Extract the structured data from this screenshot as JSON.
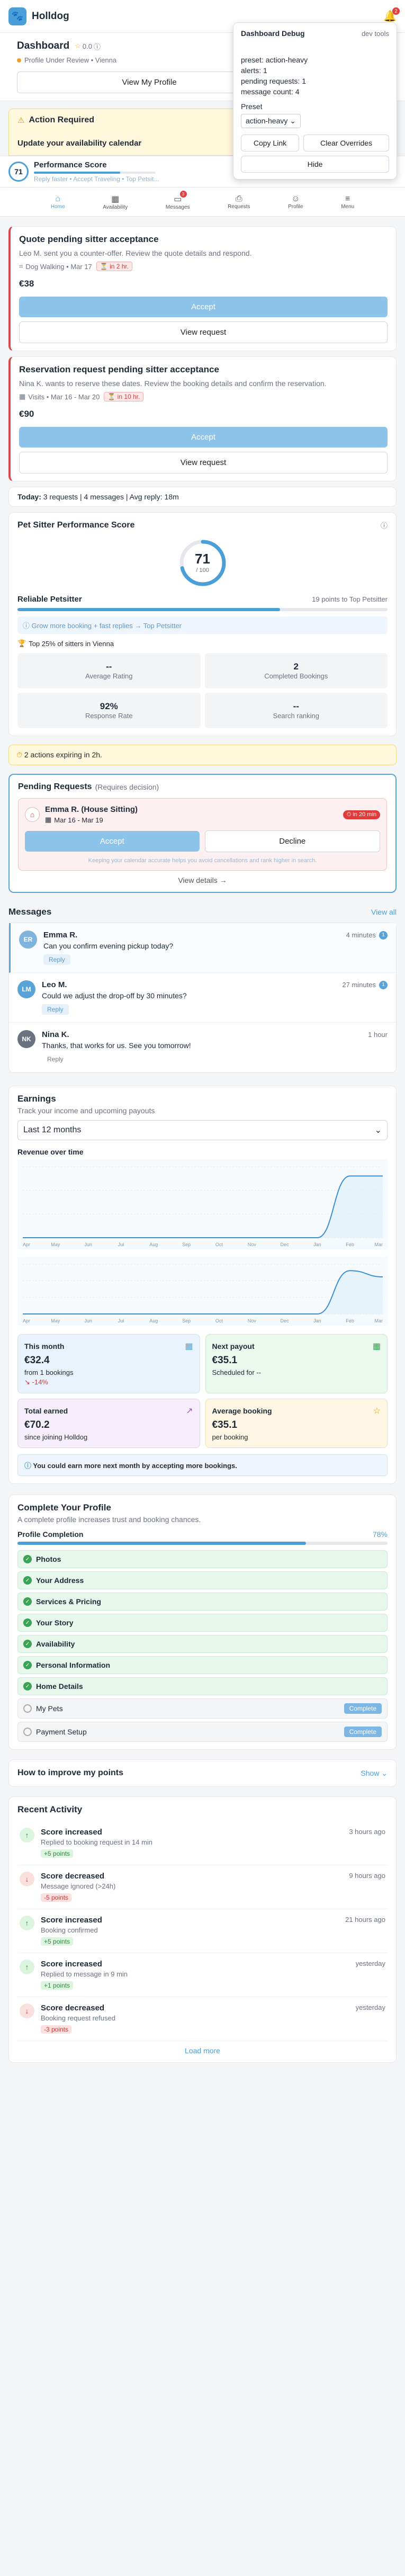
{
  "app": {
    "title": "Holldog",
    "notifications": "2"
  },
  "debug": {
    "title": "Dashboard Debug",
    "tag": "dev tools",
    "lines": [
      "preset: action-heavy",
      "alerts: 1",
      "pending requests: 1",
      "message count: 4"
    ],
    "preset_label": "Preset",
    "preset_value": "action-heavy",
    "copy_link": "Copy Link",
    "clear_overrides": "Clear Overrides",
    "hide": "Hide"
  },
  "dashboard": {
    "title": "Dashboard",
    "rating": "0.0",
    "status": "Profile Under Review • Vienna",
    "view_profile": "View My Profile"
  },
  "action_required": {
    "title": "Action Required",
    "update_calendar": "Update your availability calendar",
    "performance_title": "Performance Score",
    "performance_score": "71",
    "performance_sub": "Reply faster • Accept Traveling • Top Petsit..."
  },
  "bottom_nav": [
    {
      "label": "Home",
      "icon": "home-icon"
    },
    {
      "label": "Availability",
      "icon": "calendar-icon"
    },
    {
      "label": "Messages",
      "icon": "message-icon",
      "badge": "3"
    },
    {
      "label": "Requests",
      "icon": "inbox-icon"
    },
    {
      "label": "Profile",
      "icon": "user-icon"
    },
    {
      "label": "Menu",
      "icon": "menu-icon"
    }
  ],
  "requests": [
    {
      "title": "Quote pending sitter acceptance",
      "desc": "Leo M. sent you a counter-offer. Review the quote details and respond.",
      "meta": "Dog Walking • Mar 17",
      "timer": "in 2 hr.",
      "price": "€38",
      "accept": "Accept",
      "view": "View request"
    },
    {
      "title": "Reservation request pending sitter acceptance",
      "desc": "Nina K. wants to reserve these dates. Review the booking details and confirm the reservation.",
      "meta": "Visits • Mar 16 - Mar 20",
      "timer": "in 10 hr.",
      "price": "€90",
      "accept": "Accept",
      "view": "View request"
    }
  ],
  "today": {
    "label": "Today:",
    "text": "3 requests | 4 messages | Avg reply: 18m"
  },
  "perf_card": {
    "title": "Pet Sitter Performance Score",
    "score": "71",
    "out_of": "/ 100",
    "level": "Reliable Petsitter",
    "to_next": "19 points to Top Petsitter",
    "hint": "Grow more booking + fast replies → Top Petsitter",
    "rank": "Top 25% of sitters in Vienna",
    "stats": [
      {
        "value": "--",
        "label": "Average Rating"
      },
      {
        "value": "2",
        "label": "Completed Bookings"
      },
      {
        "value": "92%",
        "label": "Response Rate"
      },
      {
        "value": "--",
        "label": "Search ranking"
      }
    ]
  },
  "expiring": {
    "text": "2 actions expiring in 2h."
  },
  "pending": {
    "title": "Pending Requests",
    "subtitle": "(Requires decision)",
    "name": "Emma R. (House Sitting)",
    "timer": "in 20 min",
    "dates": "Mar 16 - Mar 19",
    "accept": "Accept",
    "decline": "Decline",
    "note": "Keeping your calendar accurate helps you avoid cancellations and rank higher in search.",
    "view_details": "View details →"
  },
  "messages": {
    "title": "Messages",
    "view_all": "View all",
    "items": [
      {
        "initials": "ER",
        "name": "Emma R.",
        "text": "Can you confirm evening pickup today?",
        "time": "4 minutes",
        "unread": "1",
        "reply": "Reply",
        "color": "#7fb4dc",
        "highlight": true
      },
      {
        "initials": "LM",
        "name": "Leo M.",
        "text": "Could we adjust the drop-off by 30 minutes?",
        "time": "27 minutes",
        "unread": "1",
        "reply": "Reply",
        "color": "#5aa3d6",
        "highlight": false
      },
      {
        "initials": "NK",
        "name": "Nina K.",
        "text": "Thanks, that works for us. See you tomorrow!",
        "time": "1 hour",
        "unread": "",
        "reply": "Reply",
        "color": "#6b7280",
        "highlight": false
      }
    ]
  },
  "earnings": {
    "title": "Earnings",
    "subtitle": "Track your income and upcoming payouts",
    "period": "Last 12 months",
    "chart_title": "Revenue over time",
    "months": [
      "Apr",
      "May",
      "Jun",
      "Jul",
      "Aug",
      "Sep",
      "Oct",
      "Nov",
      "Dec",
      "Jan",
      "Feb",
      "Mar"
    ],
    "this_month": {
      "label": "This month",
      "value": "€32.4",
      "sub": "from 1 bookings",
      "delta": "-14%"
    },
    "next_payout": {
      "label": "Next payout",
      "value": "€35.1",
      "sub": "Scheduled for --"
    },
    "total": {
      "label": "Total earned",
      "value": "€70.2",
      "sub": "since joining Holldog"
    },
    "average": {
      "label": "Average booking",
      "value": "€35.1",
      "sub": "per booking"
    },
    "tip": "You could earn more next month by accepting more bookings."
  },
  "chart_data": [
    {
      "type": "area",
      "x": [
        "Apr",
        "May",
        "Jun",
        "Jul",
        "Aug",
        "Sep",
        "Oct",
        "Nov",
        "Dec",
        "Jan",
        "Feb",
        "Mar"
      ],
      "series": [
        {
          "values": [
            0,
            0,
            0,
            0,
            0,
            0,
            0,
            0,
            0,
            0,
            70.2,
            70.2
          ]
        }
      ],
      "grid": true
    },
    {
      "type": "area",
      "x": [
        "Apr",
        "May",
        "Jun",
        "Jul",
        "Aug",
        "Sep",
        "Oct",
        "Nov",
        "Dec",
        "Jan",
        "Feb",
        "Mar"
      ],
      "series": [
        {
          "values": [
            0,
            0,
            0,
            0,
            0,
            0,
            0,
            0,
            0,
            0,
            37.8,
            32.4
          ]
        }
      ],
      "grid": true
    }
  ],
  "profile": {
    "title": "Complete Your Profile",
    "subtitle": "A complete profile increases trust and booking chances.",
    "completion_label": "Profile Completion",
    "completion": "78%",
    "completion_value": 78,
    "items": [
      {
        "label": "Photos",
        "done": true
      },
      {
        "label": "Your Address",
        "done": true
      },
      {
        "label": "Services & Pricing",
        "done": true
      },
      {
        "label": "Your Story",
        "done": true
      },
      {
        "label": "Availability",
        "done": true
      },
      {
        "label": "Personal Information",
        "done": true
      },
      {
        "label": "Home Details",
        "done": true
      },
      {
        "label": "My Pets",
        "done": false,
        "action": "Complete"
      },
      {
        "label": "Payment Setup",
        "done": false,
        "action": "Complete"
      }
    ]
  },
  "improve": {
    "title": "How to improve my points",
    "show": "Show ⌄"
  },
  "activity": {
    "title": "Recent Activity",
    "load_more": "Load more",
    "items": [
      {
        "title": "Score increased",
        "desc": "Replied to booking request in 14 min",
        "points": "+5 points",
        "time": "3 hours ago",
        "up": true
      },
      {
        "title": "Score decreased",
        "desc": "Message ignored (>24h)",
        "points": "-5 points",
        "time": "9 hours ago",
        "up": false
      },
      {
        "title": "Score increased",
        "desc": "Booking confirmed",
        "points": "+5 points",
        "time": "21 hours ago",
        "up": true
      },
      {
        "title": "Score increased",
        "desc": "Replied to message in 9 min",
        "points": "+1 points",
        "time": "yesterday",
        "up": true
      },
      {
        "title": "Score decreased",
        "desc": "Booking request refused",
        "points": "-3 points",
        "time": "yesterday",
        "up": false
      }
    ]
  }
}
